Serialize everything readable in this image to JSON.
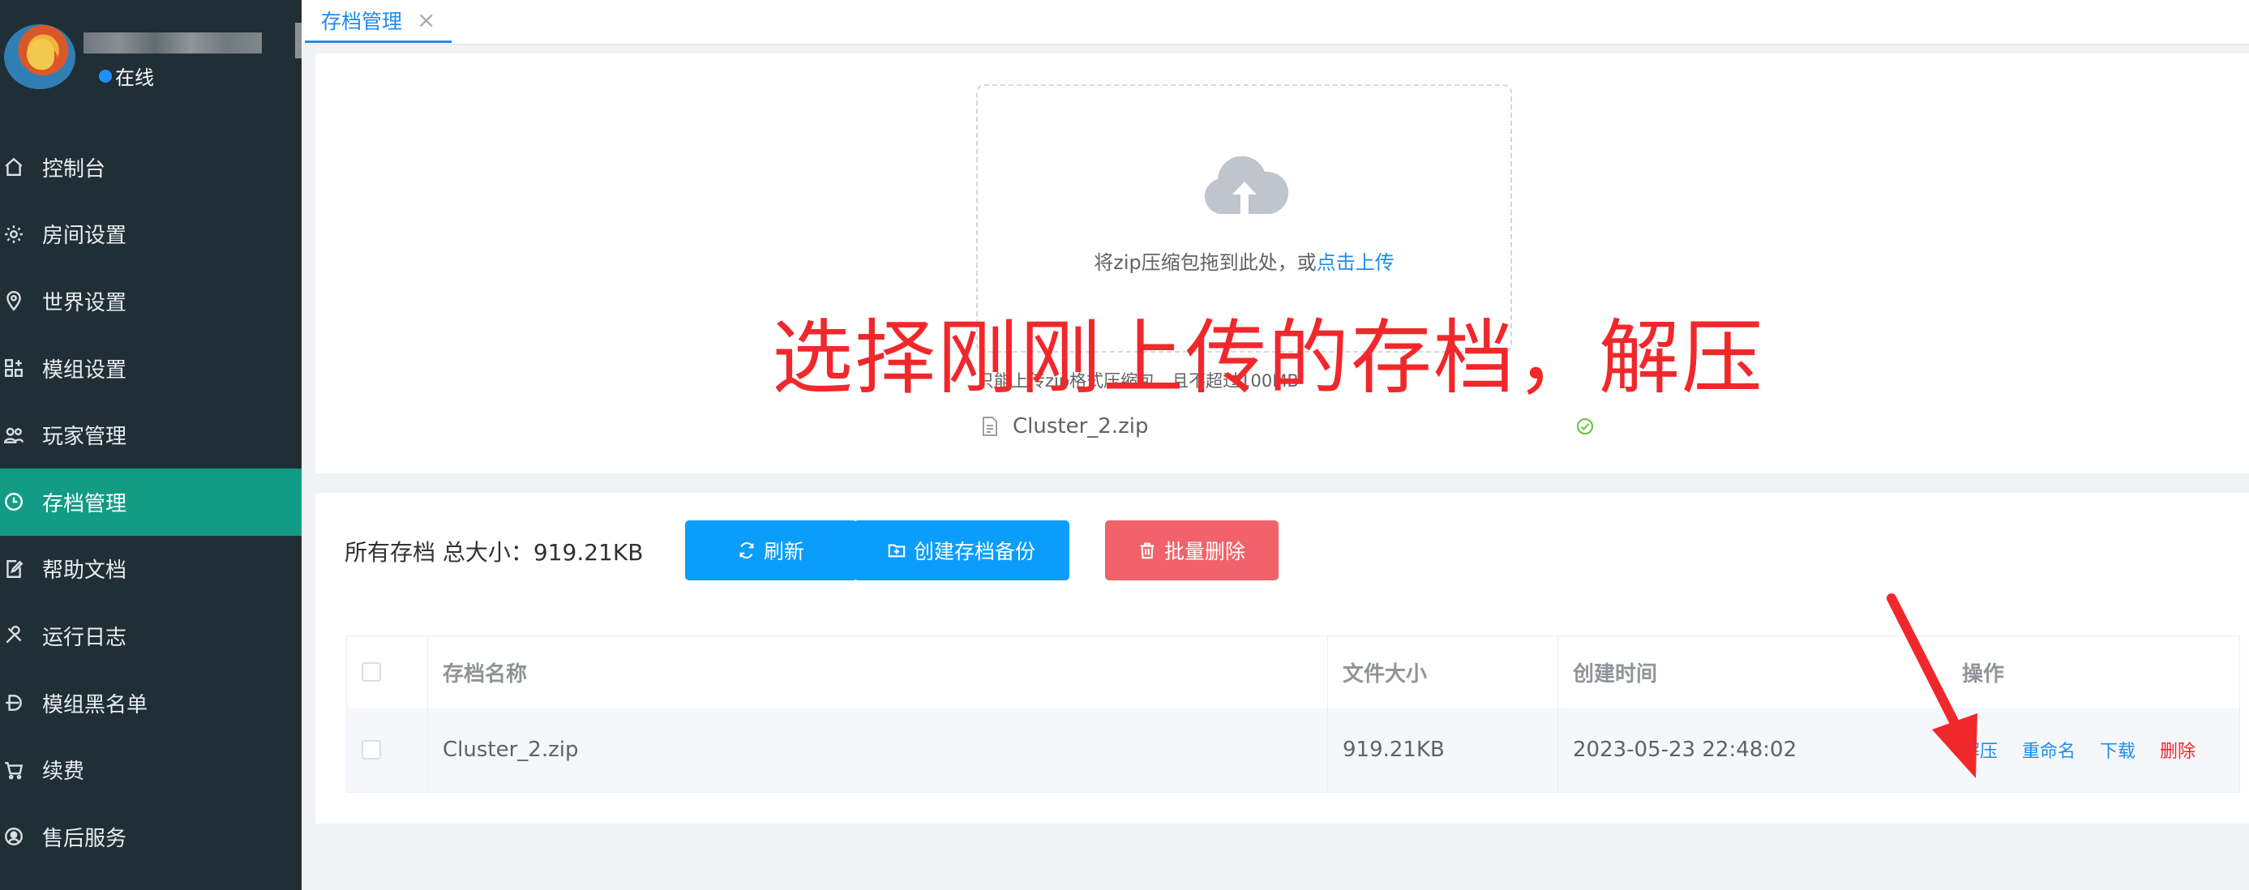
{
  "sidebar": {
    "status": "在线",
    "items": [
      {
        "label": "控制台",
        "icon": "home-icon"
      },
      {
        "label": "房间设置",
        "icon": "gear-icon"
      },
      {
        "label": "世界设置",
        "icon": "location-pin-icon"
      },
      {
        "label": "模组设置",
        "icon": "grid-plus-icon"
      },
      {
        "label": "玩家管理",
        "icon": "users-icon"
      },
      {
        "label": "存档管理",
        "icon": "clock-icon"
      },
      {
        "label": "帮助文档",
        "icon": "doc-edit-icon"
      },
      {
        "label": "运行日志",
        "icon": "tools-icon"
      },
      {
        "label": "模组黑名单",
        "icon": "block-icon"
      },
      {
        "label": "续费",
        "icon": "cart-icon"
      },
      {
        "label": "售后服务",
        "icon": "support-icon"
      }
    ],
    "active_label": "存档管理"
  },
  "tabs": [
    {
      "label": "存档管理",
      "close": "×"
    }
  ],
  "upload": {
    "drop_text": "将zip压缩包拖到此处，或",
    "drop_link": "点击上传",
    "tip": "只能上传zip格式压缩包，且不超过100MB",
    "file_name": "Cluster_2.zip"
  },
  "overlay_annotation": "选择刚刚上传的存档，解压",
  "archives": {
    "total_label": "所有存档 总大小：919.21KB",
    "buttons": {
      "refresh": "刷新",
      "backup": "创建存档备份",
      "batch_delete": "批量删除"
    },
    "columns": [
      "存档名称",
      "文件大小",
      "创建时间",
      "操作"
    ],
    "rows": [
      {
        "name": "Cluster_2.zip",
        "size": "919.21KB",
        "created": "2023-05-23 22:48:02",
        "ops": {
          "extract": "解压",
          "rename": "重命名",
          "download": "下载",
          "delete": "删除"
        }
      }
    ]
  },
  "colors": {
    "sidebar_bg": "#202e35",
    "active": "#139c85",
    "primary": "#0a9dfb",
    "danger": "#f1626b",
    "annotation": "#f0282c"
  }
}
